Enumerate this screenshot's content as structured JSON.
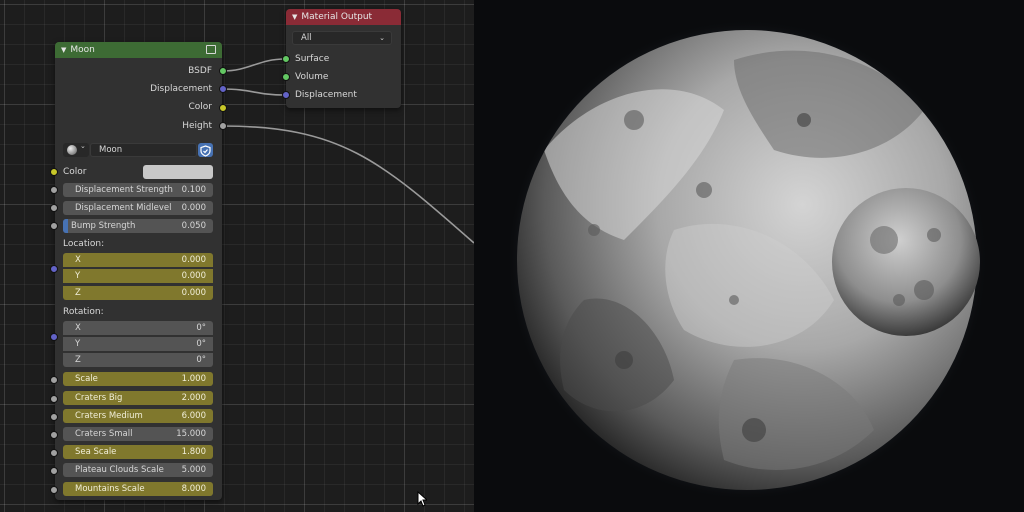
{
  "moon_node": {
    "title": "Moon",
    "outputs": [
      "BSDF",
      "Displacement",
      "Color",
      "Height"
    ],
    "datablock_name": "Moon",
    "color_label": "Color",
    "color_swatch": "#c8c8c8",
    "displacement_strength": {
      "label": "Displacement Strength",
      "value": "0.100"
    },
    "displacement_midlevel": {
      "label": "Displacement Midlevel",
      "value": "0.000"
    },
    "bump_strength": {
      "label": "Bump Strength",
      "value": "0.050"
    },
    "location": {
      "label": "Location:",
      "x_label": "X",
      "x": "0.000",
      "y_label": "Y",
      "y": "0.000",
      "z_label": "Z",
      "z": "0.000"
    },
    "rotation": {
      "label": "Rotation:",
      "x_label": "X",
      "x": "0°",
      "y_label": "Y",
      "y": "0°",
      "z_label": "Z",
      "z": "0°"
    },
    "scale": {
      "label": "Scale",
      "value": "1.000"
    },
    "craters_big": {
      "label": "Craters Big",
      "value": "2.000"
    },
    "craters_medium": {
      "label": "Craters Medium",
      "value": "6.000"
    },
    "craters_small": {
      "label": "Craters Small",
      "value": "15.000"
    },
    "sea_scale": {
      "label": "Sea Scale",
      "value": "1.800"
    },
    "plateau_clouds_scale": {
      "label": "Plateau Clouds Scale",
      "value": "5.000"
    },
    "mountains_scale": {
      "label": "Mountains Scale",
      "value": "8.000"
    }
  },
  "material_output": {
    "title": "Material Output",
    "target": "All",
    "inputs": [
      "Surface",
      "Volume",
      "Displacement"
    ]
  },
  "colors": {
    "moon_header": "#3d6b34",
    "material_header": "#8a2b36"
  }
}
